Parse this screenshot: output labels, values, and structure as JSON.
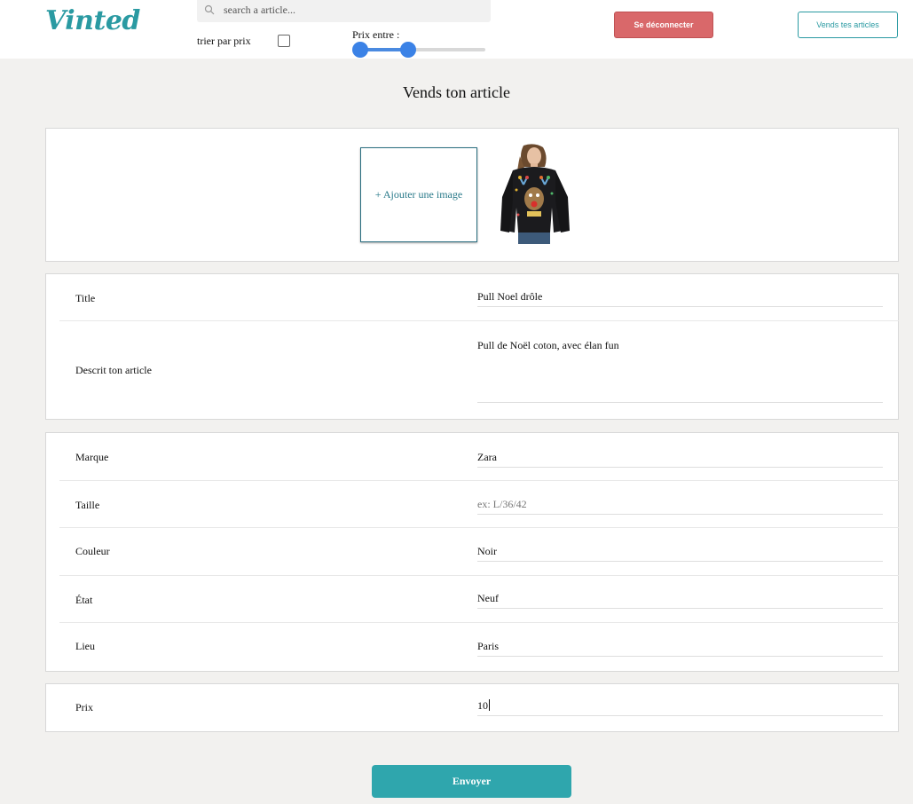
{
  "header": {
    "logo": "Vinted",
    "search_placeholder": "search a article...",
    "sort_label": "trier par prix",
    "sort_checked": false,
    "price_label": "Prix entre :",
    "price_range": {
      "min": 0,
      "max": 100,
      "low": 0,
      "high": 38
    },
    "logout_label": "Se déconnecter",
    "sell_label": "Vends tes articles"
  },
  "page": {
    "title": "Vends ton article"
  },
  "photos": {
    "add_label": "+ Ajouter une image",
    "items": [
      {
        "description_icon": "sweater-photo"
      }
    ]
  },
  "details": {
    "title_label": "Title",
    "title_value": "Pull Noel drôle",
    "description_label": "Descrit ton article",
    "description_value": "Pull de Noël coton, avec élan fun"
  },
  "attributes": {
    "brand_label": "Marque",
    "brand_value": "Zara",
    "size_label": "Taille",
    "size_placeholder": "ex: L/36/42",
    "color_label": "Couleur",
    "color_value": "Noir",
    "condition_label": "État",
    "condition_value": "Neuf",
    "location_label": "Lieu",
    "location_value": "Paris"
  },
  "pricing": {
    "price_label": "Prix",
    "price_value": "10"
  },
  "submit_label": "Envoyer",
  "colors": {
    "brand": "#2a9aa2",
    "logout": "#d9686a",
    "slider": "#3b82e6",
    "submit": "#2fa6ad"
  }
}
